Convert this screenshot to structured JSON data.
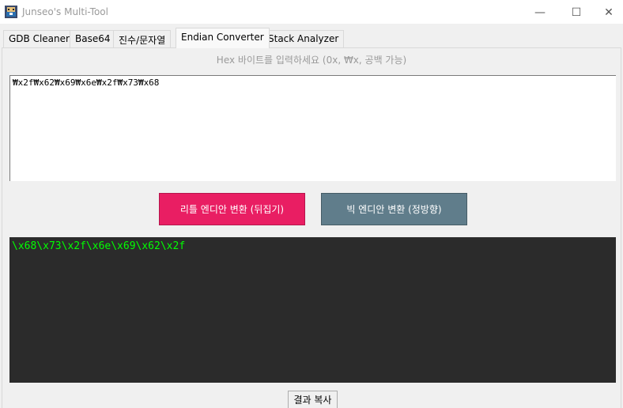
{
  "window": {
    "title": "Junseo's Multi-Tool",
    "icon": "app-icon",
    "minimize_glyph": "—",
    "maximize_glyph": "☐",
    "close_glyph": "✕"
  },
  "tabs": [
    {
      "label": "GDB Cleaner",
      "active": false
    },
    {
      "label": "Base64",
      "active": false
    },
    {
      "label": "진수/문자열",
      "active": false
    },
    {
      "label": "Endian Converter",
      "active": true
    },
    {
      "label": "Stack Analyzer",
      "active": false
    }
  ],
  "endian": {
    "hint": "Hex 바이트를 입력하세요 (0x, ₩x, 공백 가능)",
    "input_value": "₩x2f₩x62₩x69₩x6e₩x2f₩x73₩x68",
    "little_button": "리틀 엔디안 변환 (뒤집기)",
    "big_button": "빅 엔디안 변환 (정방향)",
    "output_value": "\\x68\\x73\\x2f\\x6e\\x69\\x62\\x2f",
    "copy_button": "결과 복사",
    "colors": {
      "little_button_bg": "#e91e63",
      "big_button_bg": "#607d8b",
      "output_bg": "#2b2b2b",
      "output_text": "#00ff00"
    }
  }
}
